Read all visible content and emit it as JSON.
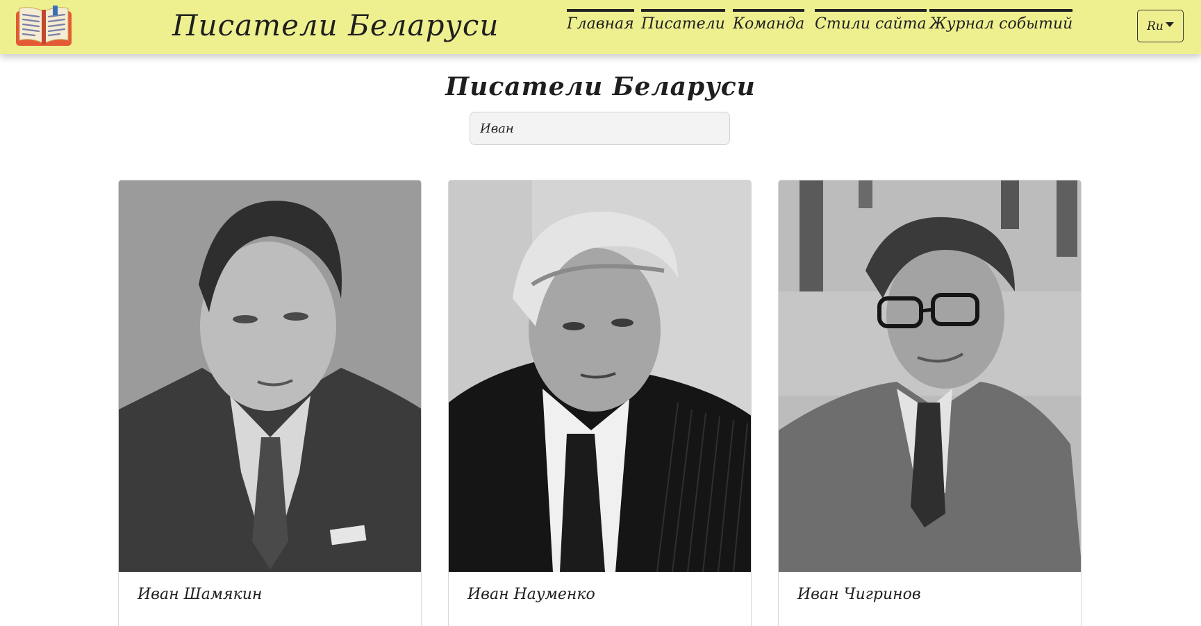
{
  "header": {
    "brand": "Писатели Беларуси",
    "nav": [
      {
        "label": "Главная",
        "icon": "top-bar"
      },
      {
        "label": "Писатели",
        "icon": "top-bar"
      },
      {
        "label": "Команда",
        "icon": "top-bar"
      },
      {
        "label": "Стили сайта",
        "icon": "top-bar"
      },
      {
        "label": "Журнал событий",
        "icon": "top-bar"
      }
    ],
    "language": "Ru",
    "logo_icon": "open-book-icon"
  },
  "main": {
    "title": "Писатели Беларуси",
    "search_value": "Иван"
  },
  "writers": [
    {
      "name": "Иван Шамякин"
    },
    {
      "name": "Иван Науменко"
    },
    {
      "name": "Иван Чигринов"
    }
  ],
  "colors": {
    "header_bg": "#eef08f",
    "logo_red": "#e45a34",
    "text": "#1f1f1f"
  }
}
